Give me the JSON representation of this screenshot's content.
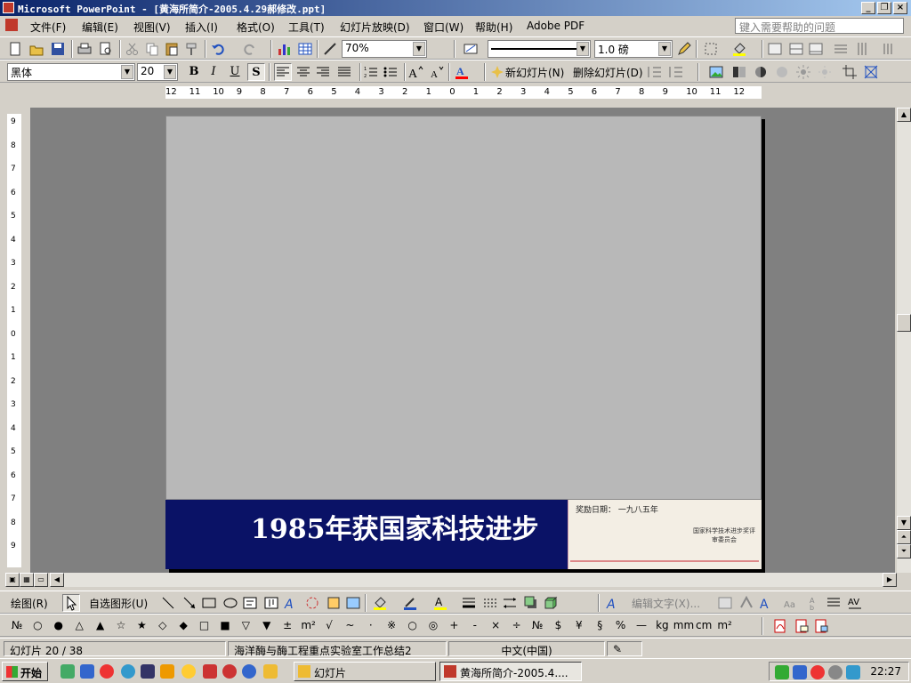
{
  "window": {
    "title": "Microsoft PowerPoint - [黄海所简介-2005.4.29郝修改.ppt]",
    "controls": [
      "_",
      "❐",
      "×"
    ]
  },
  "menu": {
    "items": [
      "文件(F)",
      "编辑(E)",
      "视图(V)",
      "插入(I)",
      "格式(O)",
      "工具(T)",
      "幻灯片放映(D)",
      "窗口(W)",
      "帮助(H)",
      "Adobe PDF"
    ],
    "help_placeholder": "键入需要帮助的问题"
  },
  "standard_toolbar": {
    "zoom": "70%",
    "line_weight": "1.0 磅"
  },
  "formatting_toolbar": {
    "font": "黑体",
    "size": "20",
    "bold": "B",
    "italic": "I",
    "underline": "U",
    "shadow": "S",
    "new_slide": "新幻灯片(N)",
    "delete_slide": "删除幻灯片(D)"
  },
  "ruler": {
    "ticks": [
      "12",
      "11",
      "10",
      "9",
      "8",
      "7",
      "6",
      "5",
      "4",
      "3",
      "2",
      "1",
      "0",
      "1",
      "2",
      "3",
      "4",
      "5",
      "6",
      "7",
      "8",
      "9",
      "10",
      "11",
      "12"
    ],
    "vticks": [
      "9",
      "8",
      "7",
      "6",
      "5",
      "4",
      "3",
      "2",
      "1",
      "0",
      "1",
      "2",
      "3",
      "4",
      "5",
      "6",
      "7",
      "8",
      "9"
    ]
  },
  "slide": {
    "caption": "1985年获国家科技进步",
    "certificate_line1": "奖励日期：  一九八五年",
    "certificate_line2": "国家科学技术进步奖评审委员会"
  },
  "drawing_toolbar": {
    "draw": "绘图(R)",
    "autoshapes": "自选图形(U)",
    "edit_text": "编辑文字(X)..."
  },
  "symbol_toolbar": {
    "symbols": [
      "№",
      "○",
      "●",
      "△",
      "▲",
      "☆",
      "★",
      "◇",
      "◆",
      "□",
      "■",
      "▽",
      "▼",
      "±",
      "m²",
      "√",
      "~",
      "·",
      "※",
      "○",
      "◎",
      "+",
      "-",
      "×",
      "÷",
      "№",
      "$",
      "¥",
      "§",
      "%",
      "—",
      "kg",
      "mm",
      "cm",
      "m²"
    ]
  },
  "statusbar": {
    "slide": "幻灯片 20 / 38",
    "design": "海洋酶与酶工程重点实验室工作总结2",
    "language": "中文(中国)"
  },
  "taskbar": {
    "start": "开始",
    "tasks": [
      "幻灯片",
      "黄海所简介-2005.4...."
    ],
    "clock": "22:27"
  },
  "colors": {
    "title_gradient_start": "#0a246a",
    "slide_band": "#0a1266",
    "workspace": "#808080"
  }
}
